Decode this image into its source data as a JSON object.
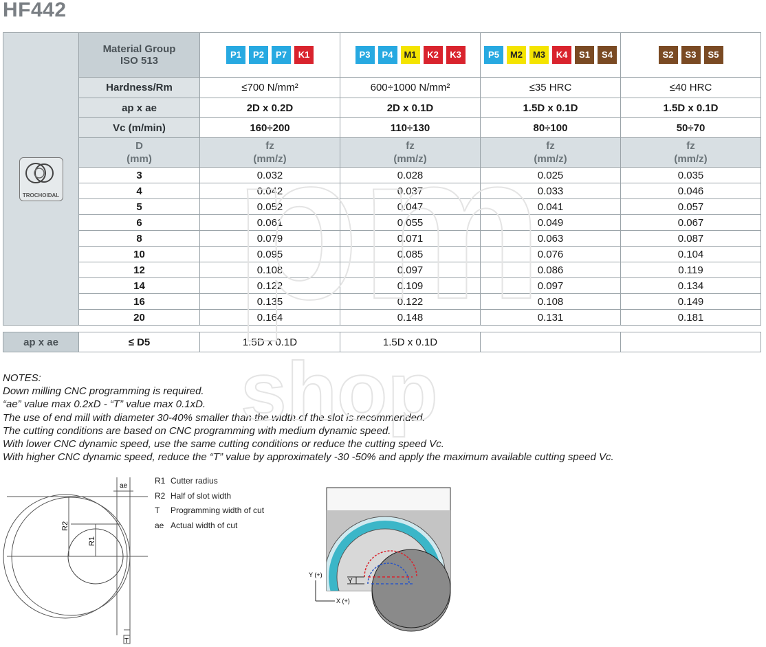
{
  "title": "HF442",
  "table": {
    "material_label_line1": "Material Group",
    "material_label_line2": "ISO 513",
    "groups": [
      {
        "badges": [
          {
            "t": "P1",
            "c": "p"
          },
          {
            "t": "P2",
            "c": "p"
          },
          {
            "t": "P7",
            "c": "p"
          },
          {
            "t": "K1",
            "c": "k"
          }
        ]
      },
      {
        "badges": [
          {
            "t": "P3",
            "c": "p"
          },
          {
            "t": "P4",
            "c": "p"
          },
          {
            "t": "M1",
            "c": "m"
          },
          {
            "t": "K2",
            "c": "k"
          },
          {
            "t": "K3",
            "c": "k"
          }
        ]
      },
      {
        "badges": [
          {
            "t": "P5",
            "c": "p"
          },
          {
            "t": "M2",
            "c": "m"
          },
          {
            "t": "M3",
            "c": "m"
          },
          {
            "t": "K4",
            "c": "k"
          },
          {
            "t": "S1",
            "c": "s"
          },
          {
            "t": "S4",
            "c": "s"
          }
        ]
      },
      {
        "badges": [
          {
            "t": "S2",
            "c": "s"
          },
          {
            "t": "S3",
            "c": "s"
          },
          {
            "t": "S5",
            "c": "s"
          }
        ]
      }
    ],
    "hardness_label": "Hardness/Rm",
    "hardness": [
      "≤700 N/mm²",
      "600÷1000 N/mm²",
      "≤35 HRC",
      "≤40 HRC"
    ],
    "apae_label": "ap x ae",
    "apae": [
      "2D x 0.2D",
      "2D x 0.1D",
      "1.5D x 0.1D",
      "1.5D x 0.1D"
    ],
    "vc_label": "Vc (m/min)",
    "vc": [
      "160÷200",
      "110÷130",
      "80÷100",
      "50÷70"
    ],
    "d_header": [
      "D",
      "(mm)"
    ],
    "fz_header": [
      "fz",
      "(mm/z)"
    ],
    "logo_label": "TROCHOIDAL",
    "rows": [
      {
        "d": "3",
        "v": [
          "0.032",
          "0.028",
          "0.025",
          "0.035"
        ]
      },
      {
        "d": "4",
        "v": [
          "0.042",
          "0.037",
          "0.033",
          "0.046"
        ]
      },
      {
        "d": "5",
        "v": [
          "0.052",
          "0.047",
          "0.041",
          "0.057"
        ]
      },
      {
        "d": "6",
        "v": [
          "0.061",
          "0.055",
          "0.049",
          "0.067"
        ]
      },
      {
        "d": "8",
        "v": [
          "0.079",
          "0.071",
          "0.063",
          "0.087"
        ]
      },
      {
        "d": "10",
        "v": [
          "0.095",
          "0.085",
          "0.076",
          "0.104"
        ]
      },
      {
        "d": "12",
        "v": [
          "0.108",
          "0.097",
          "0.086",
          "0.119"
        ]
      },
      {
        "d": "14",
        "v": [
          "0.122",
          "0.109",
          "0.097",
          "0.134"
        ]
      },
      {
        "d": "16",
        "v": [
          "0.135",
          "0.122",
          "0.108",
          "0.149"
        ]
      },
      {
        "d": "20",
        "v": [
          "0.164",
          "0.148",
          "0.131",
          "0.181"
        ]
      }
    ]
  },
  "second_table": {
    "label": "ap x ae",
    "dlabel": "≤ D5",
    "values": [
      "1.5D x 0.1D",
      "1.5D x 0.1D",
      "",
      ""
    ]
  },
  "notes": [
    "NOTES:",
    "Down milling CNC programming is required.",
    "“ae” value max 0.2xD - “T” value max 0.1xD.",
    "The use of end mill with diameter 30-40% smaller than the width of the slot is recommended.",
    "The cutting conditions are based on CNC programming with medium dynamic speed.",
    "With lower CNC dynamic speed, use the same cutting conditions or reduce the cutting speed Vc.",
    "With higher CNC dynamic speed, reduce the “T” value by approximately -30 -50% and apply the maximum available cutting speed Vc."
  ],
  "legend": [
    {
      "k": "R1",
      "v": "Cutter radius"
    },
    {
      "k": "R2",
      "v": "Half of slot width"
    },
    {
      "k": "T",
      "v": "Programming width of cut"
    },
    {
      "k": "ae",
      "v": "Actual width of cut"
    }
  ],
  "diagram_labels": {
    "ae": "ae",
    "r2": "R2",
    "r1": "R1",
    "t": "T",
    "y_axis": "Y (+)",
    "x_axis": "X (+)",
    "y_mark": "Y"
  },
  "watermark": {
    "line1": "pm",
    "line2": "shop"
  },
  "colors": {
    "p": "#27a9e1",
    "k": "#d9232d",
    "m": "#f4e400",
    "s": "#7a4a23",
    "header_bg": "#c7d0d5",
    "teal": "#3bb6c8"
  }
}
